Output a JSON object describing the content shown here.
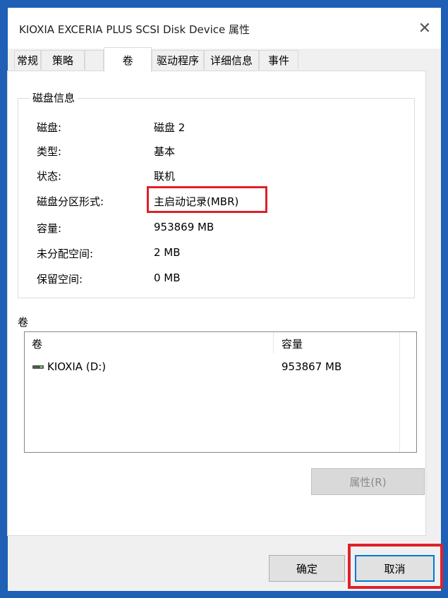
{
  "window": {
    "title": "KIOXIA EXCERIA PLUS SCSI Disk Device 属性",
    "close_glyph": "✕"
  },
  "tabs": [
    {
      "label": "常规"
    },
    {
      "label": "策略"
    },
    {
      "label": "卷",
      "active": true
    },
    {
      "label": "驱动程序"
    },
    {
      "label": "详细信息"
    },
    {
      "label": "事件"
    }
  ],
  "disk_info": {
    "legend": "磁盘信息",
    "rows": [
      {
        "label": "磁盘:",
        "value": "磁盘 2"
      },
      {
        "label": "类型:",
        "value": "基本"
      },
      {
        "label": "状态:",
        "value": "联机"
      },
      {
        "label": "磁盘分区形式:",
        "value": "主启动记录(MBR)"
      },
      {
        "label": "容量:",
        "value": "953869 MB"
      },
      {
        "label": "未分配空间:",
        "value": "2 MB"
      },
      {
        "label": "保留空间:",
        "value": "0 MB"
      }
    ]
  },
  "volumes": {
    "label": "卷",
    "columns": [
      "卷",
      "容量"
    ],
    "rows": [
      {
        "name": "KIOXIA (D:)",
        "capacity": "953867 MB",
        "icon": "drive-icon"
      }
    ],
    "properties_button": "属性(R)"
  },
  "footer": {
    "ok_label": "确定",
    "cancel_label": "取消"
  },
  "colors": {
    "highlight": "#e0202a",
    "accent": "#0078d7"
  }
}
